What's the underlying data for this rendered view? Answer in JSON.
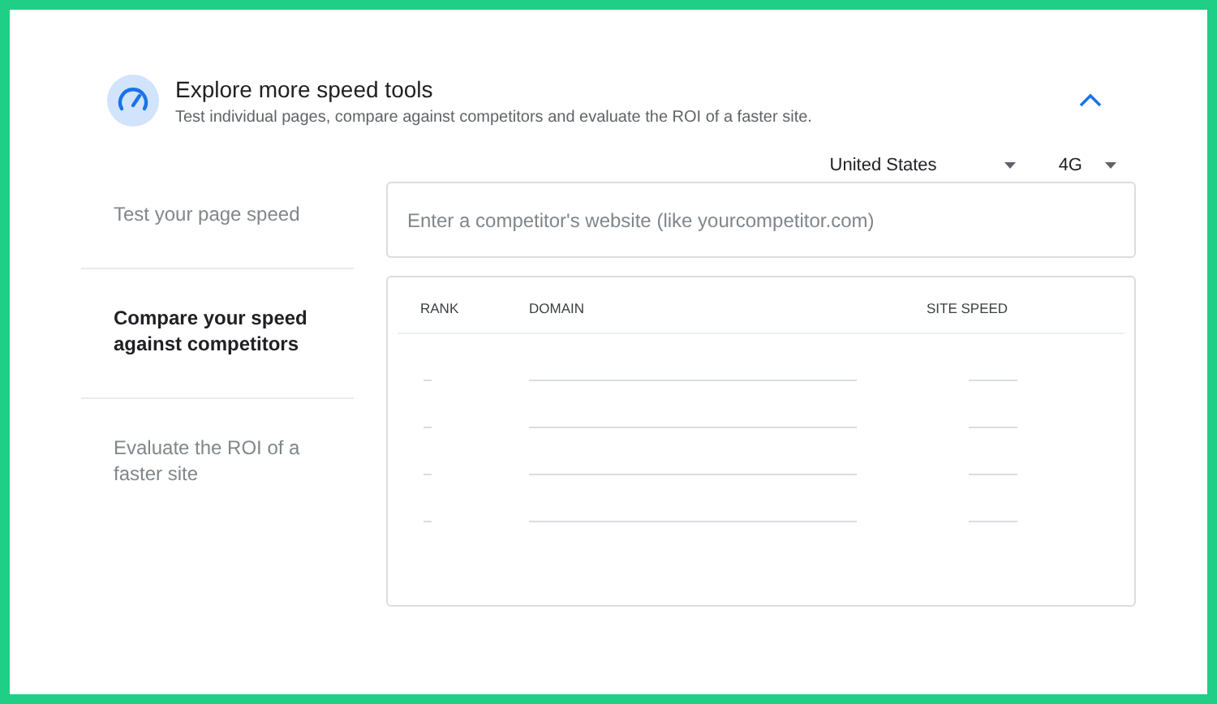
{
  "header": {
    "title": "Explore more speed tools",
    "subtitle": "Test individual pages, compare against competitors and evaluate the ROI of a faster site.",
    "expanded": true
  },
  "filters": {
    "country": "United States",
    "network": "4G"
  },
  "menu": [
    {
      "label": "Test your page speed",
      "selected": false
    },
    {
      "label": "Compare your speed against competitors",
      "selected": true
    },
    {
      "label": "Evaluate the ROI of a faster site",
      "selected": false
    }
  ],
  "competitor_field": {
    "placeholder": "Enter a competitor's website (like yourcompetitor.com)"
  },
  "table": {
    "columns": [
      "RANK",
      "DOMAIN",
      "SITE SPEED"
    ],
    "rows": [
      {
        "kind": "placeholder"
      },
      {
        "kind": "placeholder"
      },
      {
        "kind": "placeholder"
      },
      {
        "kind": "placeholder"
      }
    ]
  }
}
